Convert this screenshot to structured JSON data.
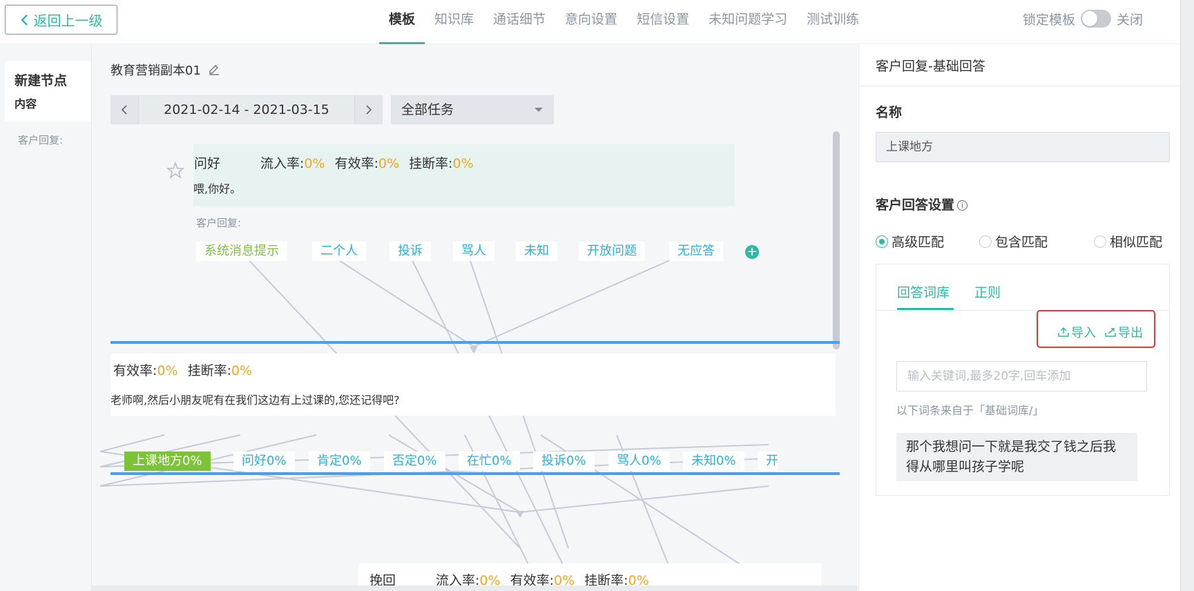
{
  "header": {
    "back_label": "返回上一级",
    "tabs": [
      "模板",
      "知识库",
      "通话细节",
      "意向设置",
      "短信设置",
      "未知问题学习",
      "测试训练"
    ],
    "active_tab": "模板",
    "lock_label": "锁定模板",
    "lock_state_label": "关闭"
  },
  "left": {
    "node_title": "新建节点",
    "node_sub": "内容",
    "reply_label": "客户回复:"
  },
  "canvas": {
    "project_name": "教育营销副本01",
    "date_range": "2021-02-14 - 2021-03-15",
    "task_filter": "全部任务",
    "node1": {
      "title": "问好",
      "inflow_label": "流入率:",
      "inflow": "0%",
      "valid_label": "有效率:",
      "valid": "0%",
      "hangup_label": "挂断率:",
      "hangup": "0%",
      "text": "喂,你好。",
      "reply_label": "客户回复:",
      "chips": [
        "系统消息提示",
        "二个人",
        "投诉",
        "骂人",
        "未知",
        "开放问题",
        "无应答"
      ]
    },
    "node2": {
      "valid_label": "有效率:",
      "valid": "0%",
      "hangup_label": "挂断率:",
      "hangup": "0%",
      "text": "老师啊,然后小朋友呢有在我们这边有上过课的,您还记得吧?",
      "chips": [
        "上课地方0%",
        "问好0%",
        "肯定0%",
        "否定0%",
        "在忙0%",
        "投诉0%",
        "骂人0%",
        "未知0%",
        "开"
      ]
    },
    "node3": {
      "title": "挽回",
      "inflow_label": "流入率:",
      "inflow": "0%",
      "valid_label": "有效率:",
      "valid": "0%",
      "hangup_label": "挂断率:",
      "hangup": "0%"
    }
  },
  "panel": {
    "title": "客户回复-基础回答",
    "name_label": "名称",
    "name_value": "上课地方",
    "setting_label": "客户回答设置",
    "radios": [
      "高级匹配",
      "包含匹配",
      "相似匹配"
    ],
    "selected_radio": "高级匹配",
    "inner_tabs": [
      "回答词库",
      "正则"
    ],
    "import_label": "导入",
    "export_label": "导出",
    "keyword_placeholder": "输入关键词,最多20字,回车添加",
    "source_note": "以下词条来自于「基础词库/」",
    "word": "那个我想问一下就是我交了钱之后我得从哪里叫孩子学呢"
  },
  "colors": {
    "accent": "#2eb8a5",
    "rate": "#f5a623",
    "chip_blue": "#2ab0d6",
    "chip_green": "#7cc33a",
    "band_blue": "#4a9df5",
    "highlight_red": "#e53935"
  }
}
